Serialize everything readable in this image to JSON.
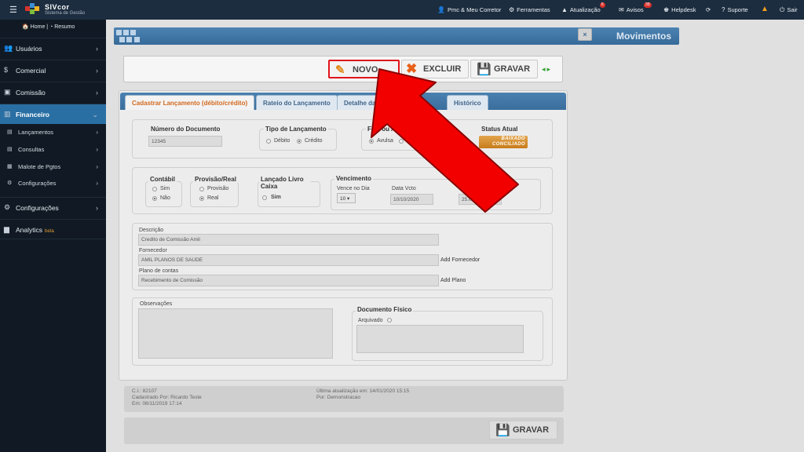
{
  "app": {
    "brand": "SIVcor",
    "brand_sub": "Sistema de Gestão"
  },
  "topnav": {
    "items": [
      {
        "label": "Pmc & Meu Corretor",
        "icon": "user-icon"
      },
      {
        "label": "Ferramentas",
        "icon": "gears-icon"
      },
      {
        "label": "Atualização",
        "icon": "warning-icon",
        "badge": "6"
      },
      {
        "label": "Avisos",
        "icon": "chat-icon",
        "badge": "39"
      },
      {
        "label": "Helpdesk",
        "icon": "helpdesk-icon"
      },
      {
        "label": "",
        "icon": "refresh-icon"
      },
      {
        "label": "Suporte",
        "icon": "question-icon"
      },
      {
        "label": "",
        "icon": "alert-icon"
      },
      {
        "label": "Sair",
        "icon": "power-icon"
      }
    ]
  },
  "sidebar": {
    "home": "Home",
    "resumo": "Resumo",
    "items": [
      {
        "label": "Usuários"
      },
      {
        "label": "Comercial"
      },
      {
        "label": "Comissão"
      },
      {
        "label": "Financeiro"
      },
      {
        "label": "Configurações"
      },
      {
        "label": "Analytics",
        "tag": "beta"
      }
    ],
    "subitems": [
      {
        "label": "Lançamentos"
      },
      {
        "label": "Consultas"
      },
      {
        "label": "Malote de Pgtos"
      },
      {
        "label": "Configurações"
      }
    ]
  },
  "page": {
    "title": "Movimentos",
    "close": "×"
  },
  "toolbar": {
    "novo": "NOVO",
    "excluir": "EXCLUIR",
    "gravar": "GRAVAR"
  },
  "tabs": [
    "Cadastrar Lançamento (débito/crédito)",
    "Rateio do Lançamento",
    "Detalhe da ba",
    "Histórico"
  ],
  "form": {
    "numero_label": "Número do Documento",
    "numero_value": "12345",
    "tipo_label": "Tipo de Lançamento",
    "tipo_debito": "Débito",
    "tipo_credito": "Crédito",
    "fixa_label": "Fixa ou Avulsa",
    "fixa_avulsa": "Avulsa",
    "fixa_fixa": "Fi",
    "status_label": "Status Atual",
    "status_value": "BAIXADO CONCILIADO",
    "contabil_label": "Contábil",
    "sim": "Sim",
    "nao": "Não",
    "provisao_label": "Provisão/Real",
    "provisao": "Provisão",
    "real": "Real",
    "livro_label": "Lançado Livro Caixa",
    "livro_sim": "Sim",
    "vencimento_label": "Vencimento",
    "vence_label": "Vence no Dia",
    "vence_value": "10",
    "data_vcto_label": "Data Vcto",
    "data_vcto_value": "10/10/2020",
    "valor_value": "25.0",
    "descricao_label": "Descrição",
    "descricao_value": "Credito de Comissão Amil",
    "fornecedor_label": "Fornecedor",
    "fornecedor_value": "AMIL PLANOS DE SAUDE",
    "add_fornecedor": "Add Fornecedor",
    "plano_label": "Plano de contas",
    "plano_value": "Recebimento de Comissão",
    "add_plano": "Add Plano",
    "obs_label": "Observações",
    "doc_label": "Documento Físico",
    "arquivado": "Arquivado"
  },
  "footer": {
    "ci": "C.I.: 82107",
    "cadastrado": "Cadastrado Por: Ricardo Teste",
    "em": "Em: 08/11/2019 17:14",
    "ultima": "Última atualização em: 14/01/2020 15:15",
    "por": "Por: Demonstracao"
  },
  "bottom": {
    "gravar": "GRAVAR"
  },
  "colors": {
    "accent": "#2a6fa3",
    "highlight": "#e0151b",
    "arrow": "#f00000",
    "topbar": "#1c2d3f",
    "sidebar": "#111a24"
  }
}
